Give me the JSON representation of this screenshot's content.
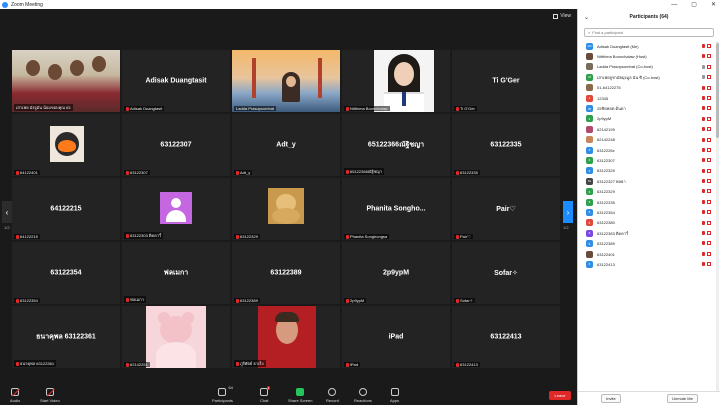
{
  "window": {
    "title": "Zoom Meeting"
  },
  "view": {
    "label": "View"
  },
  "gallery": {
    "tiles": [
      {
        "big": "",
        "label": "เสาเฟย มังจูมัน น้อมขอบคุณ 63",
        "mic_off": false,
        "pic": "students"
      },
      {
        "big": "Adisak Duangtasit",
        "label": "Adisak Duangtasit",
        "mic_off": true
      },
      {
        "big": "",
        "label": "Ladda Prasopsombat",
        "mic_off": false,
        "pic": "bridge"
      },
      {
        "big": "",
        "label": "Nitthima Boonchalaw",
        "mic_off": true,
        "pic": "portrait"
      },
      {
        "big": "Ti G'Ger",
        "label": "Ti G'Ger",
        "mic_off": true
      },
      {
        "big": "",
        "label": "64122401",
        "mic_off": true,
        "pic": "cartoon"
      },
      {
        "big": "63122307",
        "label": "63122307",
        "mic_off": true
      },
      {
        "big": "Adt_y",
        "label": "Adt_y",
        "mic_off": true
      },
      {
        "big": "65122366ณัฐิชญา",
        "label": "65122366ณัฐิชญา",
        "mic_off": true
      },
      {
        "big": "63122335",
        "label": "63122335",
        "mic_off": true
      },
      {
        "big": "64122215",
        "label": "64122215",
        "mic_off": true
      },
      {
        "big": "",
        "label": "63122303 ติดดาวิ์",
        "mic_off": true,
        "pic": "avatar"
      },
      {
        "big": "",
        "label": "63122329",
        "mic_off": true,
        "pic": "bear"
      },
      {
        "big": "Phanita Songho...",
        "label": "Phanita Songhongsa",
        "mic_off": true
      },
      {
        "big": "Pair♡",
        "label": "Pair♡",
        "mic_off": true
      },
      {
        "big": "63122354",
        "label": "63122354",
        "mic_off": true
      },
      {
        "big": "ฟลเมกา",
        "label": "ฟลเมกา",
        "mic_off": true
      },
      {
        "big": "63122389",
        "label": "63122389",
        "mic_off": true
      },
      {
        "big": "2p9ypM",
        "label": "2p9ypM",
        "mic_off": true
      },
      {
        "big": "Sofar✧",
        "label": "Sofar✧",
        "mic_off": true
      },
      {
        "big": "ธนาคุพล 63122361",
        "label": "ธนาคุพล 63122361",
        "mic_off": true
      },
      {
        "big": "",
        "label": "62142251",
        "mic_off": true,
        "pic": "pink"
      },
      {
        "big": "",
        "label": "ภูริศัตย์ ธาเร็ง",
        "mic_off": true,
        "pic": "red"
      },
      {
        "big": "iPad",
        "label": "iPad",
        "mic_off": true
      },
      {
        "big": "63122413",
        "label": "63122413",
        "mic_off": true
      }
    ],
    "left_page": "1/2",
    "right_page": "1/2"
  },
  "toolbar": {
    "audio": "Audio",
    "start_video": "Start Video",
    "participants": "Participants",
    "participants_count": "64",
    "chat": "Chat",
    "chat_badge": "1",
    "share_screen": "Share Screen",
    "record": "Record",
    "reactions": "Reactions",
    "apps": "Apps",
    "leave": "Leave"
  },
  "panel": {
    "title": "Participants (64)",
    "search_placeholder": "Find a participant",
    "participants": [
      {
        "initials": "AD",
        "color": "#2f8de4",
        "name": "Adisak Duangtasit (Me)",
        "mic_ok": false
      },
      {
        "initials": "",
        "color": "#6a4a3a",
        "name": "Nitthima Boonchalaw (Host)",
        "mic_ok": false
      },
      {
        "initials": "",
        "color": "#7a6a5a",
        "name": "Ladda Prasopsombat (Co-host)",
        "mic_ok": true
      },
      {
        "initials": "เส",
        "color": "#2ea04a",
        "name": "เสาเฟยจูชามัยมุ่งมูล ฉัน ซิ (Co-host)",
        "mic_ok": true
      },
      {
        "initials": "",
        "color": "#8a6a4a",
        "name": "01-64122275",
        "mic_ok": false
      },
      {
        "initials": "1",
        "color": "#e0483a",
        "name": "12345",
        "mic_ok": false
      },
      {
        "initials": "25",
        "color": "#2f8de4",
        "name": "25ชิดพลต ต้นดา",
        "mic_ok": false
      },
      {
        "initials": "2",
        "color": "#2ea04a",
        "name": "2p9ypM",
        "mic_ok": false
      },
      {
        "initials": "",
        "color": "#b04a6a",
        "name": "62142199",
        "mic_ok": false
      },
      {
        "initials": "",
        "color": "#c7855a",
        "name": "62142248",
        "mic_ok": false
      },
      {
        "initials": "6",
        "color": "#2f8de4",
        "name": "6312226x",
        "mic_ok": false
      },
      {
        "initials": "6",
        "color": "#2ea04a",
        "name": "63122307",
        "mic_ok": false
      },
      {
        "initials": "6",
        "color": "#2f8de4",
        "name": "63122325",
        "mic_ok": false
      },
      {
        "initials": "6s",
        "color": "#444444",
        "name": "63122327 พลยา",
        "mic_ok": false
      },
      {
        "initials": "6",
        "color": "#2ea04a",
        "name": "63122329",
        "mic_ok": false
      },
      {
        "initials": "6",
        "color": "#2ea04a",
        "name": "63122335",
        "mic_ok": false
      },
      {
        "initials": "6",
        "color": "#2f8de4",
        "name": "63122354",
        "mic_ok": false
      },
      {
        "initials": "6",
        "color": "#e0483a",
        "name": "63122380",
        "mic_ok": false
      },
      {
        "initials": "6",
        "color": "#7a4ae0",
        "name": "63122383 ติดดาวิ์",
        "mic_ok": false
      },
      {
        "initials": "6",
        "color": "#2f8de4",
        "name": "63122389",
        "mic_ok": false
      },
      {
        "initials": "",
        "color": "#6a4a3a",
        "name": "63122401",
        "mic_ok": false
      },
      {
        "initials": "6",
        "color": "#2f8de4",
        "name": "63122413",
        "mic_ok": false
      }
    ],
    "invite": "Invite",
    "unmute_me": "Unmute Me"
  }
}
